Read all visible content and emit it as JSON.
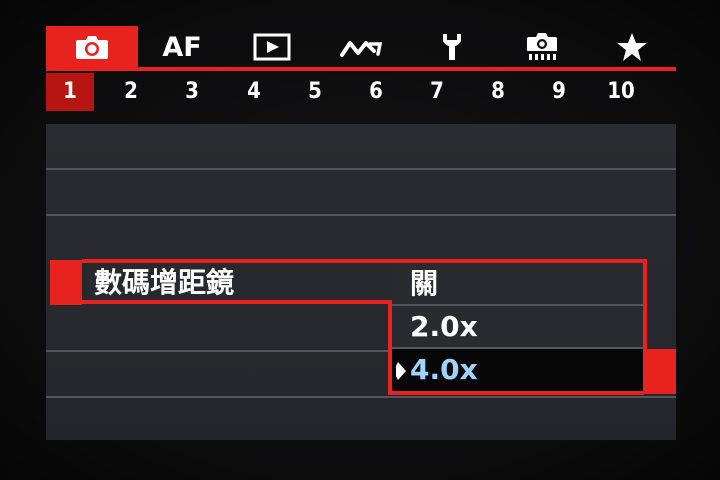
{
  "tabs": [
    {
      "id": "shooting",
      "icon": "camera-icon",
      "active": true
    },
    {
      "id": "af",
      "label": "AF",
      "active": false
    },
    {
      "id": "playback",
      "icon": "play-icon",
      "active": false
    },
    {
      "id": "wireless",
      "icon": "wireless-icon",
      "active": false
    },
    {
      "id": "setup",
      "icon": "wrench-icon",
      "active": false
    },
    {
      "id": "custom",
      "icon": "custom-camera-icon",
      "active": false
    },
    {
      "id": "mymenu",
      "icon": "star-icon",
      "active": false
    }
  ],
  "pages": [
    "1",
    "2",
    "3",
    "4",
    "5",
    "6",
    "7",
    "8",
    "9",
    "10"
  ],
  "active_page": "1",
  "menu": {
    "item_label": "數碼增距鏡"
  },
  "dropdown": {
    "options": [
      "關",
      "2.0x",
      "4.0x"
    ],
    "selected": "4.0x"
  },
  "colors": {
    "accent": "#e8221f",
    "selected_text": "#9fd3ff",
    "background": "#2b2c31"
  }
}
